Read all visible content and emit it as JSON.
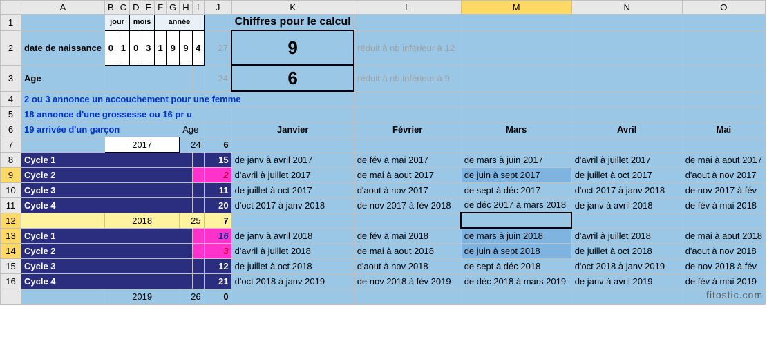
{
  "columns": [
    "A",
    "B",
    "C",
    "D",
    "E",
    "F",
    "G",
    "H",
    "I",
    "J",
    "K",
    "L",
    "M",
    "N",
    "O"
  ],
  "selected_column": "M",
  "rows": 17,
  "selected_rows": [
    9,
    12,
    13,
    14
  ],
  "header_small": {
    "jour": "jour",
    "mois": "mois",
    "annee": "année"
  },
  "date_label": "date de naissance",
  "date_digits": [
    "0",
    "1",
    "0",
    "3",
    "1",
    "9",
    "9",
    "4"
  ],
  "calc_title": "Chiffres pour le calcul",
  "calc_sub_27": "27",
  "calc_box_9": "9",
  "calc_note_9": "réduit à nb inférieur à 12",
  "age_label": "Age",
  "calc_sub_24": "24",
  "calc_box_6": "6",
  "calc_note_6": "réduit à nb inférieur à 9",
  "note4": "2 ou 3 annonce un accouchement pour une femme",
  "note5": "18 annonce d'une grossesse ou 16 pr u",
  "note6": "19 arrivée d'un garçon",
  "age_col_label": "Age",
  "months": {
    "jan": "Janvier",
    "feb": "Février",
    "mar": "Mars",
    "apr": "Avril",
    "may": "Mai"
  },
  "year1": {
    "year": "2017",
    "age": "24",
    "val": "6"
  },
  "year2": {
    "year": "2018",
    "age": "25",
    "val": "7"
  },
  "year3": {
    "year": "2019",
    "age": "26",
    "val": "0"
  },
  "cycles": {
    "c1l": "Cycle 1",
    "c2l": "Cycle 2",
    "c3l": "Cycle 3",
    "c4l": "Cycle 4",
    "y1": {
      "c1j": "15",
      "c2j": "2",
      "c3j": "11",
      "c4j": "20",
      "c1": {
        "k": "de janv à avril 2017",
        "l": "de fév à mai 2017",
        "m": "de mars à juin 2017",
        "n": "d'avril à juillet 2017",
        "o": "de mai à aout 2017"
      },
      "c2": {
        "k": "d'avril à juillet 2017",
        "l": "de mai à aout 2017",
        "m": "de juin à sept 2017",
        "n": "de juillet à oct 2017",
        "o": "d'aout à nov 2017"
      },
      "c3": {
        "k": "de juillet à oct 2017",
        "l": "d'aout à nov 2017",
        "m": "de sept à déc 2017",
        "n": "d'oct 2017 à janv 2018",
        "o": "de nov 2017 à fév"
      },
      "c4": {
        "k": "d'oct 2017 à janv 2018",
        "l": "de nov 2017 à fév 2018",
        "m": "de déc 2017 à mars 2018",
        "n": "de janv à avril 2018",
        "o": "de fév à mai 2018"
      }
    },
    "y2": {
      "c1j": "16",
      "c2j": "3",
      "c3j": "12",
      "c4j": "21",
      "c1": {
        "k": "de janv à avril 2018",
        "l": "de fév à mai 2018",
        "m": "de mars à juin 2018",
        "n": "d'avril à juillet 2018",
        "o": "de mai à aout 2018"
      },
      "c2": {
        "k": "d'avril à juillet 2018",
        "l": "de mai à aout 2018",
        "m": "de juin à sept 2018",
        "n": "de juillet à oct 2018",
        "o": "d'aout à nov 2018"
      },
      "c3": {
        "k": "de juillet à oct 2018",
        "l": "d'aout à nov 2018",
        "m": "de sept à déc 2018",
        "n": "d'oct 2018 à janv 2019",
        "o": "de nov 2018 à fév"
      },
      "c4": {
        "k": "d'oct 2018 à janv 2019",
        "l": "de nov 2018 à fév 2019",
        "m": "de déc 2018 à mars 2019",
        "n": "de janv à avril 2019",
        "o": "de fév à mai 2019"
      }
    }
  },
  "watermark": "fitostic.com"
}
